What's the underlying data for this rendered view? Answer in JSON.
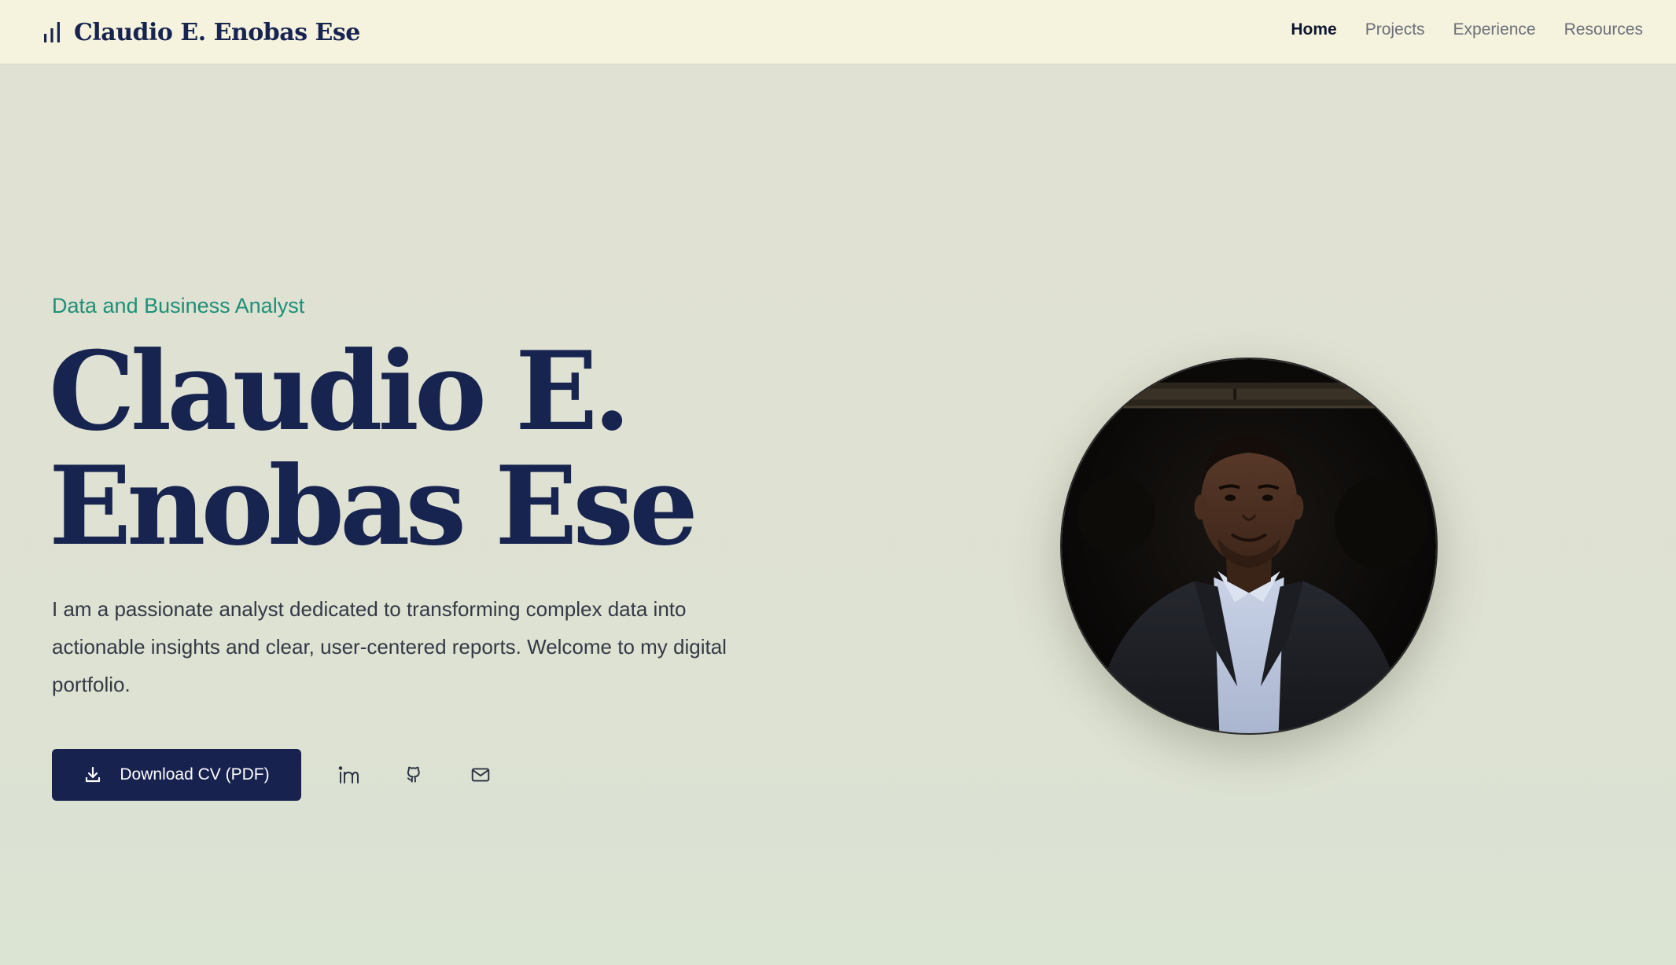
{
  "header": {
    "brand_name": "Claudio E. Enobas Ese",
    "brand_icon": "bar-chart-icon",
    "nav": [
      {
        "label": "Home",
        "active": true
      },
      {
        "label": "Projects",
        "active": false
      },
      {
        "label": "Experience",
        "active": false
      },
      {
        "label": "Resources",
        "active": false
      }
    ]
  },
  "hero": {
    "subtitle": "Data and Business Analyst",
    "name_line1": "Claudio E.",
    "name_line2": "Enobas Ese",
    "bio": "I am a passionate analyst dedicated to transforming complex data into actionable insights and clear, user-centered reports. Welcome to my digital portfolio.",
    "download_label": "Download CV (PDF)",
    "download_icon": "download-icon",
    "social": [
      {
        "icon": "linkedin-icon"
      },
      {
        "icon": "github-icon"
      },
      {
        "icon": "mail-icon"
      }
    ],
    "portrait": "profile-photo"
  },
  "colors": {
    "header_bg": "#f5f2de",
    "page_bg": "#e0e1d3",
    "navy": "#17244f",
    "accent_teal": "#1e8f78",
    "body_text": "#333946",
    "nav_inactive": "#6b6f78"
  }
}
